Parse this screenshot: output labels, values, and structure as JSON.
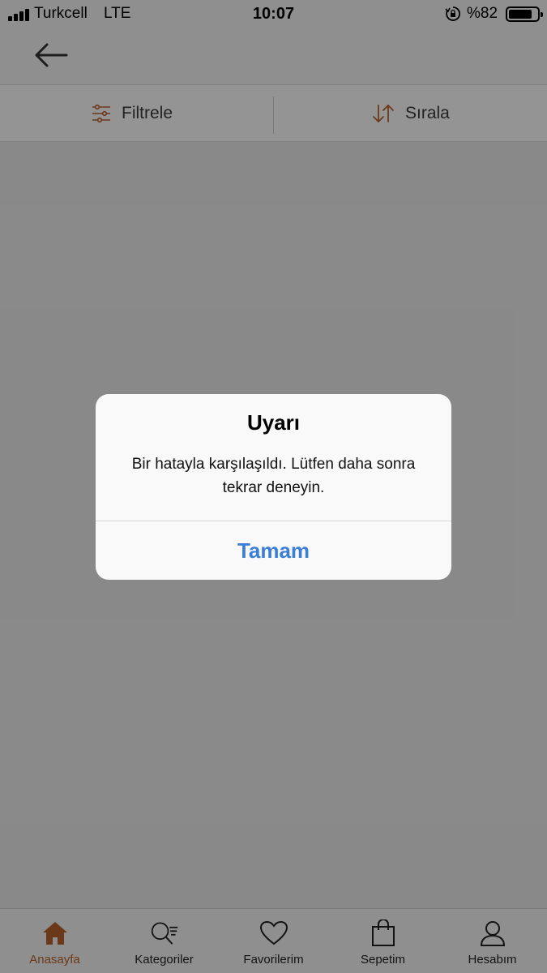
{
  "status_bar": {
    "carrier": "Turkcell",
    "network": "LTE",
    "time": "10:07",
    "battery_label": "%82",
    "battery_level": 0.82,
    "signal_icon": "signal-bars-icon",
    "orientation_lock_icon": "orientation-lock-icon",
    "battery_icon": "battery-icon"
  },
  "header": {
    "back_icon": "arrow-left-icon"
  },
  "filter_bar": {
    "filter_label": "Filtrele",
    "filter_icon": "sliders-icon",
    "sort_label": "Sırala",
    "sort_icon": "sort-arrows-icon"
  },
  "alert": {
    "title": "Uyarı",
    "message": "Bir hatayla karşılaşıldı. Lütfen daha sonra tekrar deneyin.",
    "ok_label": "Tamam"
  },
  "tab_bar": {
    "items": [
      {
        "label": "Anasayfa",
        "icon": "home-icon",
        "active": true
      },
      {
        "label": "Kategoriler",
        "icon": "search-list-icon",
        "active": false
      },
      {
        "label": "Favorilerim",
        "icon": "heart-icon",
        "active": false
      },
      {
        "label": "Sepetim",
        "icon": "shopping-bag-icon",
        "active": false
      },
      {
        "label": "Hesabım",
        "icon": "user-icon",
        "active": false
      }
    ]
  },
  "colors": {
    "accent": "#b8612b",
    "alert_button": "#3b7ed6",
    "overlay": "rgba(0,0,0,0.42)"
  }
}
